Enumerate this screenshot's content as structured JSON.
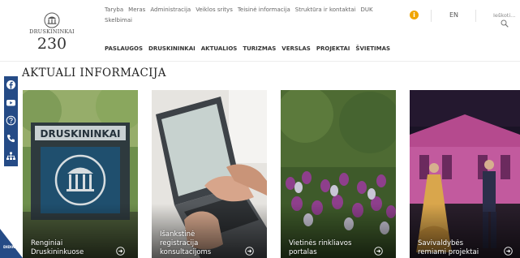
{
  "logo": {
    "name": "DRUSKININKAI",
    "number": "230"
  },
  "toplinks": {
    "row1": [
      "Taryba",
      "Meras",
      "Administracija",
      "Veiklos sritys",
      "Teisinė informacija",
      "Struktūra ir kontaktai",
      "DUK"
    ],
    "row2": [
      "Skelbimai"
    ]
  },
  "header": {
    "info_icon": "i",
    "language": "EN",
    "search_label": "Ieškoti..."
  },
  "mainnav": [
    "PASLAUGOS",
    "DRUSKININKAI",
    "AKTUALIOS",
    "TURIZMAS",
    "VERSLAS",
    "PROJEKTAI",
    "ŠVIETIMAS"
  ],
  "section": {
    "title": "AKTUALI INFORMACIJA"
  },
  "social": [
    "facebook-icon",
    "youtube-icon",
    "question-icon",
    "phone-icon",
    "sitemap-icon"
  ],
  "corner_label": "DIDINTI",
  "cards": [
    {
      "title_lines": [
        "Renginiai",
        "Druskininkuose"
      ],
      "image": "Druskininkai sign with pavilion logo"
    },
    {
      "title_lines": [
        "Išankstinė",
        "registracija",
        "konsultacijoms"
      ],
      "image": "hands typing on laptop"
    },
    {
      "title_lines": [
        "Vietinės rinkliavos",
        "portalas"
      ],
      "image": "tulip field"
    },
    {
      "title_lines": [
        "Savivaldybės",
        "remiami projektai"
      ],
      "image": "dancers at night event"
    }
  ],
  "colors": {
    "accent": "#254b86",
    "info": "#f0a500",
    "text": "#333333"
  }
}
